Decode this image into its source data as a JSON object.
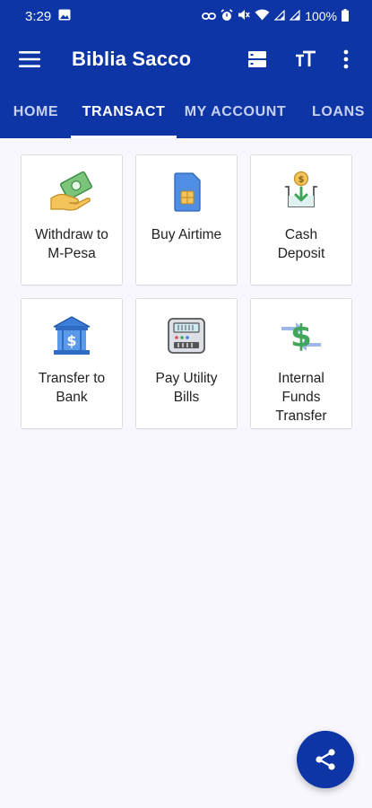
{
  "status_bar": {
    "time": "3:29",
    "battery": "100%"
  },
  "app_bar": {
    "title": "Biblia Sacco",
    "menu_icon": "hamburger-menu-icon",
    "actions": [
      "storage-icon",
      "text-size-icon",
      "more-vert-icon"
    ]
  },
  "tabs": [
    {
      "label": "HOME",
      "active": false
    },
    {
      "label": "TRANSACT",
      "active": true
    },
    {
      "label": "MY ACCOUNT",
      "active": false
    },
    {
      "label": "LOANS",
      "active": false
    }
  ],
  "tiles": [
    {
      "label": "Withdraw to\nM-Pesa",
      "icon": "cash-hand-icon"
    },
    {
      "label": "Buy Airtime",
      "icon": "sim-card-icon"
    },
    {
      "label": "Cash\nDeposit",
      "icon": "cash-deposit-icon"
    },
    {
      "label": "Transfer to\nBank",
      "icon": "bank-icon"
    },
    {
      "label": "Pay Utility\nBills",
      "icon": "utility-meter-icon"
    },
    {
      "label": "Internal\nFunds\nTransfer",
      "icon": "funds-transfer-icon"
    }
  ],
  "fab": {
    "icon": "share-icon"
  },
  "colors": {
    "primary": "#0d35a6",
    "background": "#f8f7fd"
  }
}
